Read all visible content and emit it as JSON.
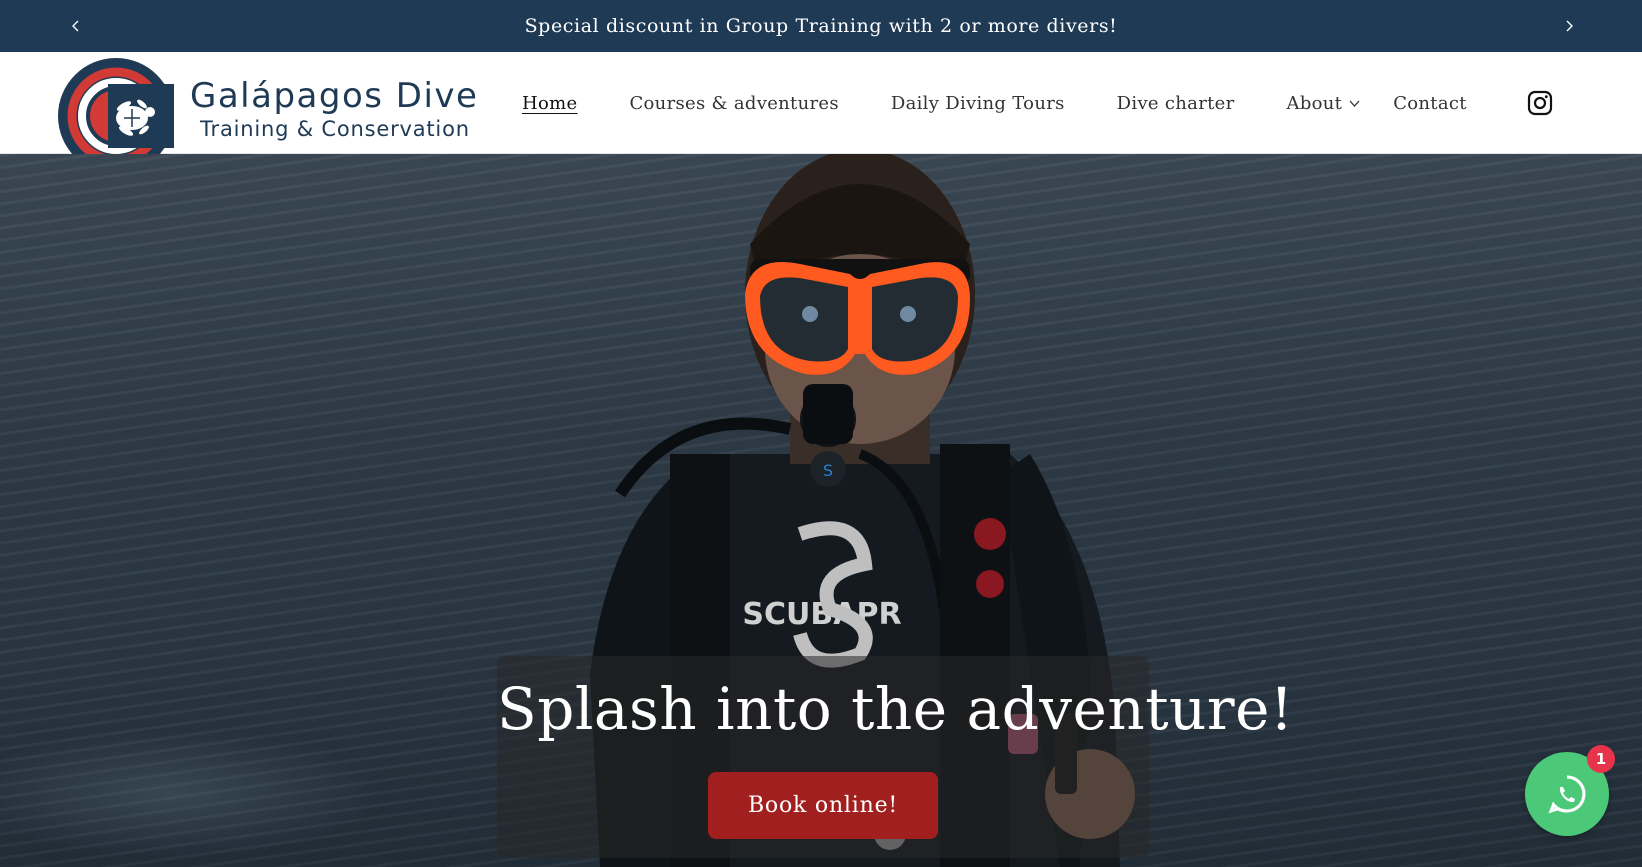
{
  "announcement": {
    "text": "Special discount in Group Training with 2 or more divers!",
    "prev_icon": "chevron-left-icon",
    "next_icon": "chevron-right-icon"
  },
  "logo": {
    "title": "Galápagos Dive",
    "subtitle": "Training & Conservation"
  },
  "nav": {
    "items": [
      {
        "label": "Home",
        "active": true
      },
      {
        "label": "Courses & adventures"
      },
      {
        "label": "Daily Diving Tours"
      },
      {
        "label": "Dive charter"
      },
      {
        "label": "About",
        "dropdown": true
      },
      {
        "label": "Contact"
      }
    ],
    "social_icon": "instagram-icon"
  },
  "hero": {
    "title": "Splash into the adventure!",
    "cta_label": "Book online!"
  },
  "chat_widget": {
    "icon": "whatsapp-icon",
    "badge_count": "1"
  },
  "colors": {
    "navy": "#1f3a55",
    "cta_red": "#a1201f",
    "whatsapp_green": "#4cc978",
    "badge_red": "#e8344a"
  }
}
